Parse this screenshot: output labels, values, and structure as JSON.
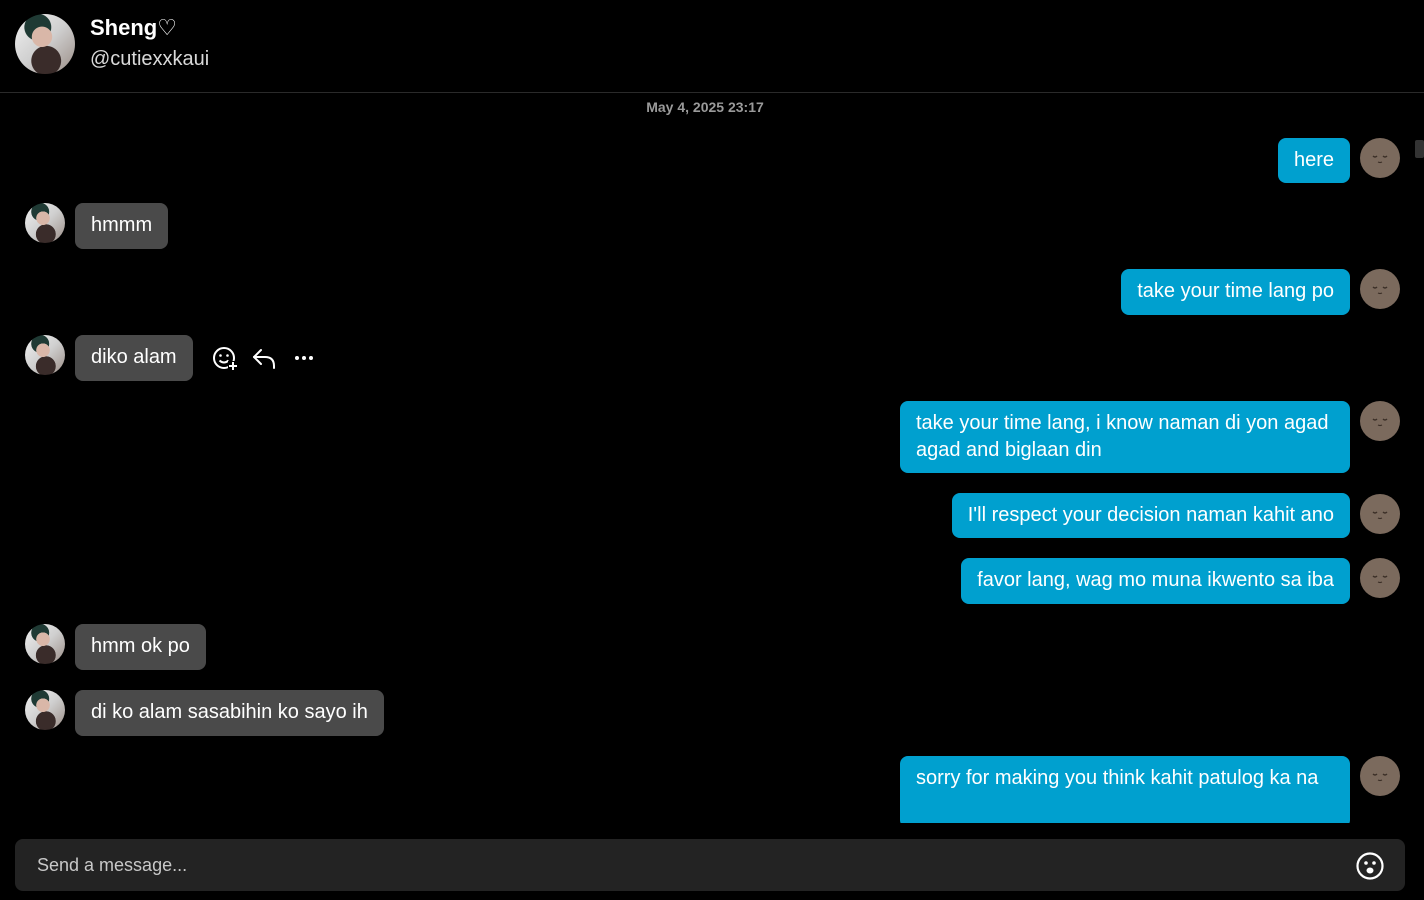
{
  "header": {
    "name": "Sheng♡",
    "handle": "@cutiexxkaui"
  },
  "timestamp": "May 4, 2025 23:17",
  "messages": [
    {
      "from": "me",
      "text": "here"
    },
    {
      "from": "them",
      "text": "hmmm"
    },
    {
      "from": "me",
      "text": "take your time lang po"
    },
    {
      "from": "them",
      "text": "diko alam"
    },
    {
      "from": "me",
      "text": "take your time lang, i know naman di yon agad agad and biglaan din"
    },
    {
      "from": "me",
      "text": "I'll respect your decision naman kahit ano"
    },
    {
      "from": "me",
      "text": "favor lang, wag mo muna ikwento sa iba"
    },
    {
      "from": "them",
      "text": "hmm ok po"
    },
    {
      "from": "them",
      "text": "di ko alam sasabihin ko sayo ih"
    },
    {
      "from": "me",
      "text": "sorry for making you think kahit patulog ka na"
    }
  ],
  "message_actions": [
    "add-reaction-icon",
    "reply-icon",
    "more-options-icon"
  ],
  "composer": {
    "placeholder": "Send a message...",
    "emoji_icon": "emoji-icon"
  },
  "colors": {
    "background": "#000000",
    "my_bubble": "#00a0cf",
    "their_bubble": "#4a4a4a",
    "composer_bg": "#232323"
  }
}
